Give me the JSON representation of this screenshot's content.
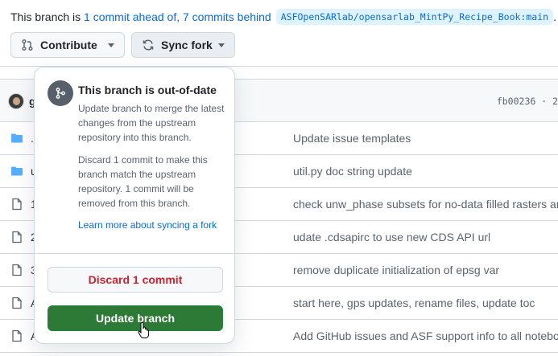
{
  "banner": {
    "prefix": "This branch is",
    "ahead_link": "1 commit ahead of,",
    "behind_link": "7 commits behind",
    "upstream_branch": "ASFOpenSARlab/opensarlab_MintPy_Recipe_Book:main",
    "suffix": "."
  },
  "toolbar": {
    "contribute_label": "Contribute",
    "sync_fork_label": "Sync fork"
  },
  "commit_bar": {
    "author_fragment": "g",
    "hash_fragment": "fb00236 · 2"
  },
  "rows": [
    {
      "type": "folder",
      "name_fragment": ".",
      "message": "Update issue templates"
    },
    {
      "type": "folder",
      "name_fragment": "u",
      "message": "util.py doc string update"
    },
    {
      "type": "file",
      "name_fragment": "1",
      "message": "check unw_phase subsets for no-data filled rasters an"
    },
    {
      "type": "file",
      "name_fragment": "2",
      "message": "udate .cdsapirc to use new CDS API url"
    },
    {
      "type": "file",
      "name_fragment": "3",
      "message": "remove duplicate initialization of epsg var"
    },
    {
      "type": "file",
      "name_fragment": "A",
      "message": "start here, gps updates, rename files, update toc"
    },
    {
      "type": "file",
      "name_fragment": "A",
      "message": "Add GitHub issues and ASF support info to all notebo"
    }
  ],
  "popover": {
    "title": "This branch is out-of-date",
    "description_update": "Update branch to merge the latest changes from the upstream repository into this branch.",
    "description_discard": "Discard 1 commit to make this branch match the upstream repository. 1 commit will be removed from this branch.",
    "learn_more": "Learn more about syncing a fork",
    "discard_label": "Discard 1 commit",
    "update_label": "Update branch",
    "icon": "git-merge-icon"
  },
  "colors": {
    "link": "#0969da",
    "danger": "#cf222e",
    "primary": "#2c7a35",
    "folder": "#54aeff",
    "muted": "#59636e"
  }
}
